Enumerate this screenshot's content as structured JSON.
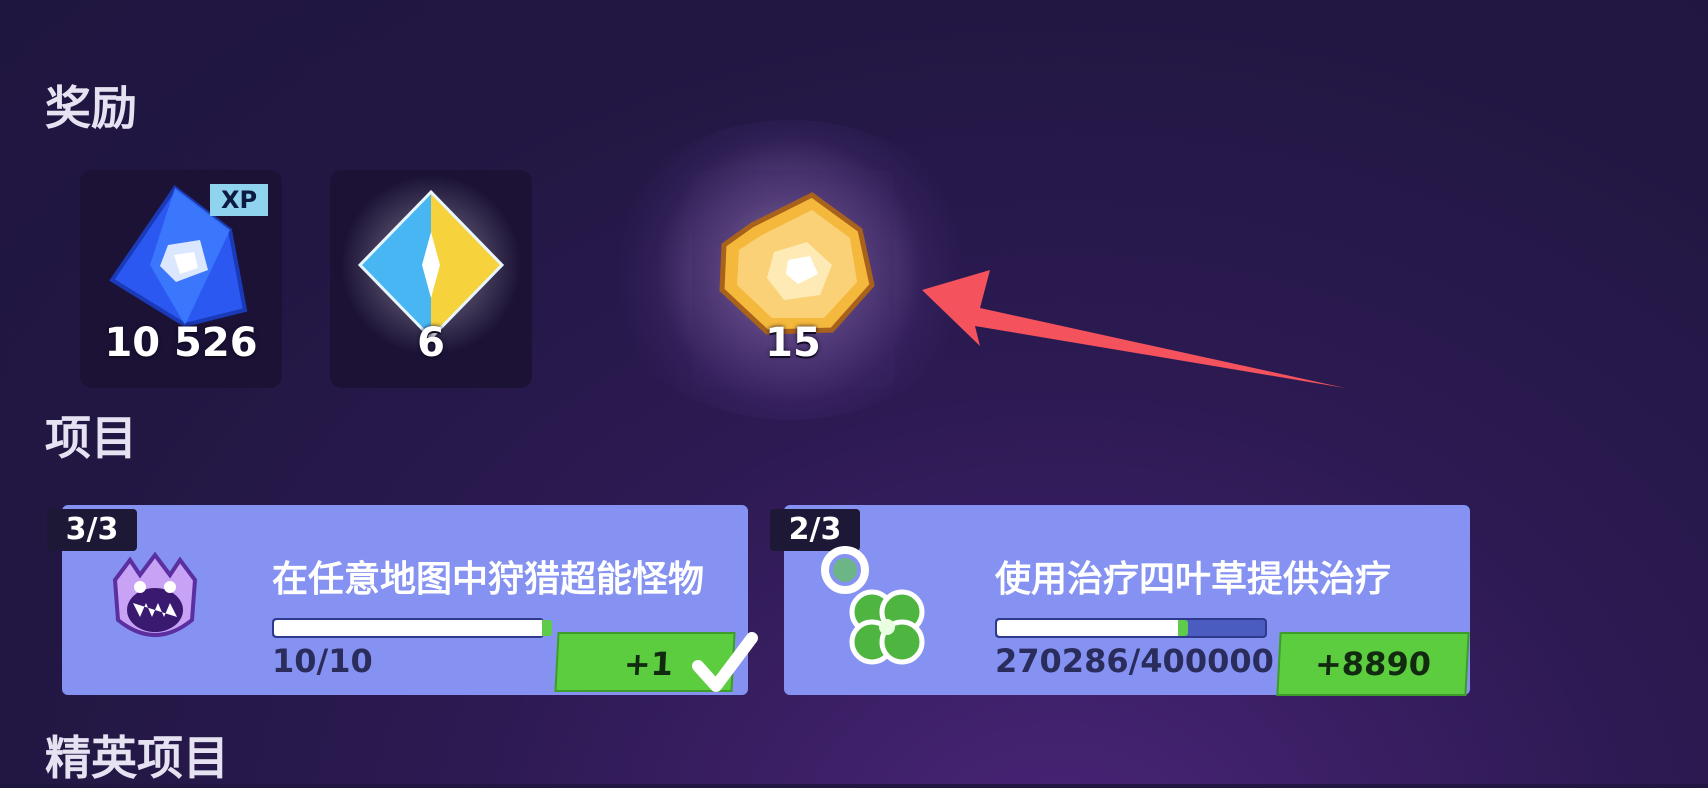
{
  "sections": {
    "rewards_title": "奖励",
    "projects_title": "项目",
    "elite_projects_title": "精英项目"
  },
  "rewards": [
    {
      "icon": "xp-crystal-icon",
      "value": "10 526",
      "badge": "XP"
    },
    {
      "icon": "gem-icon",
      "value": "6"
    },
    {
      "icon": "gold-coin-icon",
      "value": "15"
    }
  ],
  "projects": [
    {
      "counter": "3/3",
      "icon": "monster-icon",
      "title": "在任意地图中狩猎超能怪物",
      "progress_text": "10/10",
      "progress_fraction": 1.0,
      "reward": "+1",
      "completed": true
    },
    {
      "counter": "2/3",
      "icon": "four-leaf-clover-icon",
      "title": "使用治疗四叶草提供治疗",
      "progress_text": "270286/400000",
      "progress_fraction": 0.6757,
      "reward": "+8890",
      "completed": false
    }
  ],
  "colors": {
    "background": "#241845",
    "card": "#8592f1",
    "reward_green": "#5bcd3f",
    "arrow": "#f4525d"
  }
}
